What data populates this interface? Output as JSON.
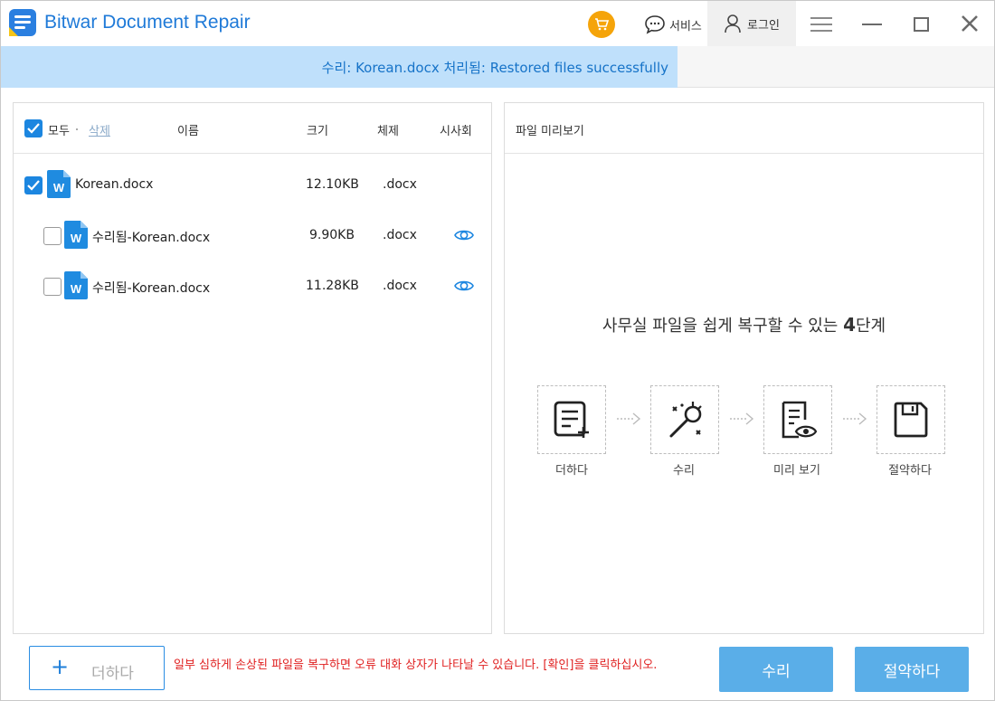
{
  "app": {
    "title": "Bitwar Document Repair"
  },
  "header": {
    "service_label": "서비스",
    "login_label": "로그인"
  },
  "status": {
    "message": "수리: Korean.docx 처리됨: Restored files successfully"
  },
  "list": {
    "columns": {
      "all": "모두",
      "delete": "삭제",
      "name": "이름",
      "size": "크기",
      "format": "체제",
      "preview": "시사회"
    },
    "rows": [
      {
        "name": "Korean.docx",
        "size": "12.10KB",
        "format": ".docx",
        "checked": true,
        "has_preview": false
      },
      {
        "name": "수리됨-Korean.docx",
        "size": "9.90KB",
        "format": ".docx",
        "checked": false,
        "has_preview": true
      },
      {
        "name": "수리됨-Korean.docx",
        "size": "11.28KB",
        "format": ".docx",
        "checked": false,
        "has_preview": true
      }
    ]
  },
  "preview": {
    "title": "파일 미리보기",
    "steps_heading_prefix": "사무실 파일을 쉽게 복구할 수 있는 ",
    "steps_heading_number": "4",
    "steps_heading_suffix": "단계",
    "steps": [
      {
        "label": "더하다",
        "icon": "add-document-icon"
      },
      {
        "label": "수리",
        "icon": "repair-tools-icon"
      },
      {
        "label": "미리 보기",
        "icon": "preview-document-icon"
      },
      {
        "label": "절약하다",
        "icon": "save-floppy-icon"
      }
    ]
  },
  "footer": {
    "add_label": "더하다",
    "warning": "일부 심하게 손상된 파일을 복구하면 오류 대화 상자가 나타날 수 있습니다. [확인]을 클릭하십시오.",
    "repair_label": "수리",
    "save_label": "절약하다"
  },
  "colors": {
    "accent": "#1c86e0",
    "status_bg": "#bfe0fb",
    "warning": "#e02020",
    "cart": "#f5a40a",
    "action_button": "#5aaee8"
  }
}
